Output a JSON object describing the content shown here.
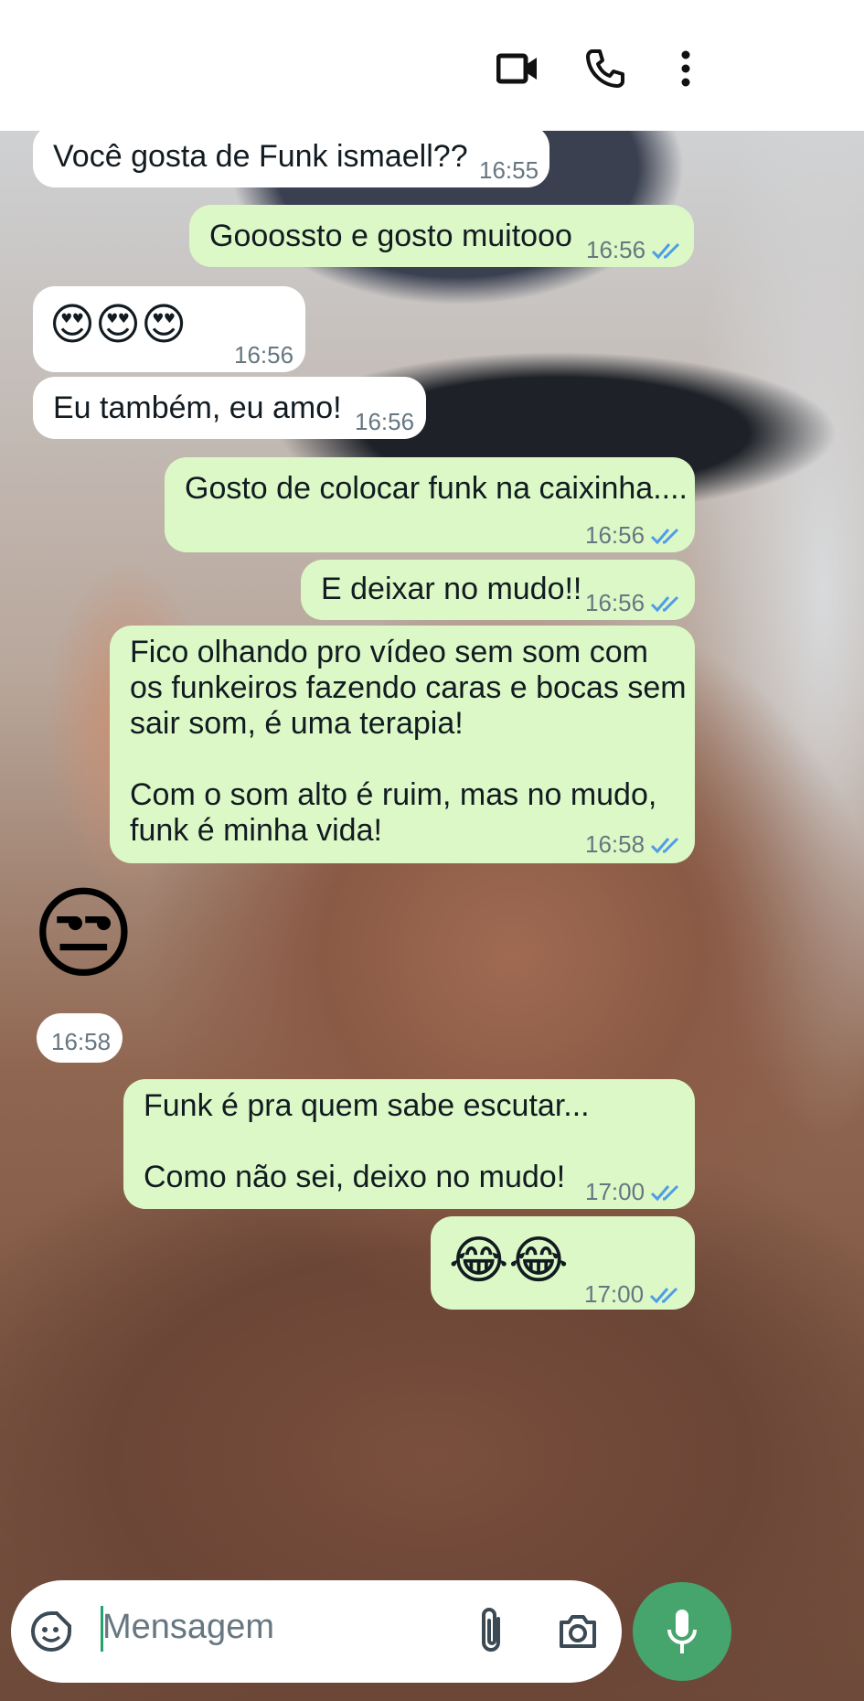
{
  "header": {
    "icons": [
      "video-call-icon",
      "phone-icon",
      "more-options-icon"
    ]
  },
  "messages": [
    {
      "dir": "in",
      "text": "Você gosta de Funk ismaell??",
      "time": "16:55"
    },
    {
      "dir": "out",
      "text": "Gooossto e gosto muitooo",
      "time": "16:56"
    },
    {
      "dir": "in",
      "text": "😍😍😍",
      "time": "16:56"
    },
    {
      "dir": "in",
      "text": "Eu também, eu amo!",
      "time": "16:56"
    },
    {
      "dir": "out",
      "text": "Gosto de colocar funk na caixinha....",
      "time": "16:56"
    },
    {
      "dir": "out",
      "text": "E deixar no mudo!!",
      "time": "16:56"
    },
    {
      "dir": "out",
      "text": "Fico olhando pro vídeo sem som com\nos funkeiros fazendo caras e bocas sem\nsair som, é uma terapia!\n\nCom o som alto é ruim, mas no mudo,\nfunk é minha vida!",
      "time": "16:58"
    },
    {
      "dir": "in",
      "text": "😒",
      "time": "16:58"
    },
    {
      "dir": "out",
      "text": "Funk é pra quem sabe escutar...\n\nComo não sei, deixo no mudo!",
      "time": "17:00"
    },
    {
      "dir": "out",
      "text": "😂😂",
      "time": "17:00"
    }
  ],
  "composer": {
    "placeholder": "Mensagem",
    "icons": [
      "sticker-icon",
      "attach-icon",
      "camera-icon",
      "mic-icon"
    ]
  },
  "colors": {
    "outgoing_bubble": "#dcf8c6",
    "incoming_bubble": "#ffffff",
    "read_ticks": "#4f9ce8",
    "mic_button": "#45a56d"
  }
}
